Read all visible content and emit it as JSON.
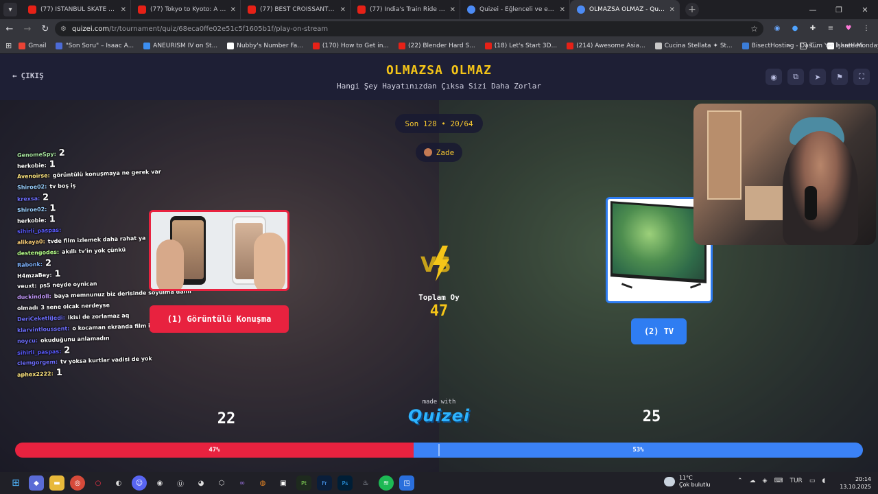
{
  "browser": {
    "tabs": [
      {
        "title": "(77) ISTANBUL SKATE LIFE - You",
        "fav": "yt"
      },
      {
        "title": "(77) Tokyo to Kyoto: A Salaryma",
        "fav": "yt"
      },
      {
        "title": "(77) BEST CROISSANT IN PARIS",
        "fav": "yt"
      },
      {
        "title": "(77) India's Train Ride from Hel",
        "fav": "yt"
      },
      {
        "title": "Quizei - Eğlenceli ve etkileşimli",
        "fav": "qz"
      },
      {
        "title": "OLMAZSA OLMAZ - Quizei",
        "fav": "qz",
        "active": true
      }
    ],
    "url_host": "quizei.com",
    "url_path": "/tr/tournament/quiz/68eca0ffe02e51c5f1605b1f/play-on-stream",
    "bookmarks": [
      "Gmail",
      "\"Son Soru\" – Isaac A...",
      "ANEURISM IV on St...",
      "Nubby's Number Fa...",
      "(170) How to Get in...",
      "(22) Blender Hard S...",
      "(18) Let's Start 3D...",
      "(214) Awesome Asia...",
      "Cucina Stellata ✦ St...",
      "BisectHosting - Das...",
      "I hate Mondays (@s..."
    ],
    "bookmarks_more": "»",
    "all_bookmarks": "Tüm Yer İşaretleri"
  },
  "page": {
    "exit_label": "ÇIKIŞ",
    "title": "OLMAZSA OLMAZ",
    "subtitle": "Hangi Şey Hayatınızdan Çıksa Sizi Daha Zorlar",
    "round": "Son 128 • 20/64",
    "user": "Zade",
    "vs": "VS",
    "total_label": "Toplam Oy",
    "total_value": "47",
    "left_option": "(1) Görüntülü Konuşma",
    "right_option": "(2) TV",
    "left_count": "22",
    "right_count": "25",
    "left_pct": "47%",
    "right_pct": "53%",
    "left_fraction": 0.47,
    "made_with": "made with",
    "brand": "Quizei",
    "accent": "#f5c518",
    "left_color": "#e8223f",
    "right_color": "#3b82f6"
  },
  "chat": [
    {
      "user": "GenomeSpy:",
      "color": "#a8e6a0",
      "text": "2",
      "big": true
    },
    {
      "user": "herkobie:",
      "color": "#ffffff",
      "text": "1",
      "big": true
    },
    {
      "user": "Avenoirse:",
      "color": "#ffe680",
      "text": "görüntülü konuşmaya ne gerek var"
    },
    {
      "user": "Shiroe02:",
      "color": "#9ad0ff",
      "text": "tv boş iş"
    },
    {
      "user": "krexsa:",
      "color": "#6f6fff",
      "text": "2",
      "big": true
    },
    {
      "user": "Shiroe02:",
      "color": "#9ad0ff",
      "text": "1",
      "big": true
    },
    {
      "user": "herkobie:",
      "color": "#ffffff",
      "text": "1",
      "big": true
    },
    {
      "user": "sihirli_paspas:",
      "color": "#5b5bff",
      "text": ""
    },
    {
      "user": "alikaya0:",
      "color": "#ffd27a",
      "text": "tvde film izlemek daha rahat ya"
    },
    {
      "user": "destengodes:",
      "color": "#b6ff8a",
      "text": "akıllı tv'in yok çünkü"
    },
    {
      "user": "Rabonk:",
      "color": "#7fb3ff",
      "text": "2",
      "big": true
    },
    {
      "user": "H4mzaBey:",
      "color": "#ffffff",
      "text": "1",
      "big": true
    },
    {
      "user": "veuxt:",
      "color": "#ffffff",
      "text": "ps5 neyde oynican"
    },
    {
      "user": "duckindoll:",
      "color": "#c79bff",
      "text": "baya memnunuz biz derisinde soyulma dahil"
    },
    {
      "user": "olmadı",
      "color": "#ffffff",
      "text": "3 sene olcak nerdeyse"
    },
    {
      "user": "DeriCeketliJedi:",
      "color": "#6f6fff",
      "text": "ikisi de zorlamaz aq"
    },
    {
      "user": "klarvintloussent:",
      "color": "#6f6fff",
      "text": "o kocaman ekranda film izleme keyfi başkadır."
    },
    {
      "user": "noycu:",
      "color": "#6f6fff",
      "text": "okuduğunu anlamadın"
    },
    {
      "user": "sihirli_paspas:",
      "color": "#5b5bff",
      "text": "2",
      "big": true
    },
    {
      "user": "clemgorgem:",
      "color": "#6f6fff",
      "text": "tv yoksa kurtlar vadisi de yok"
    },
    {
      "user": "aphex2222:",
      "color": "#ffe680",
      "text": "1",
      "big": true
    }
  ],
  "taskbar": {
    "weather_temp": "11°C",
    "weather_desc": "Çok bulutlu",
    "lang": "TUR",
    "time": "20:14",
    "date": "13.10.2025"
  }
}
